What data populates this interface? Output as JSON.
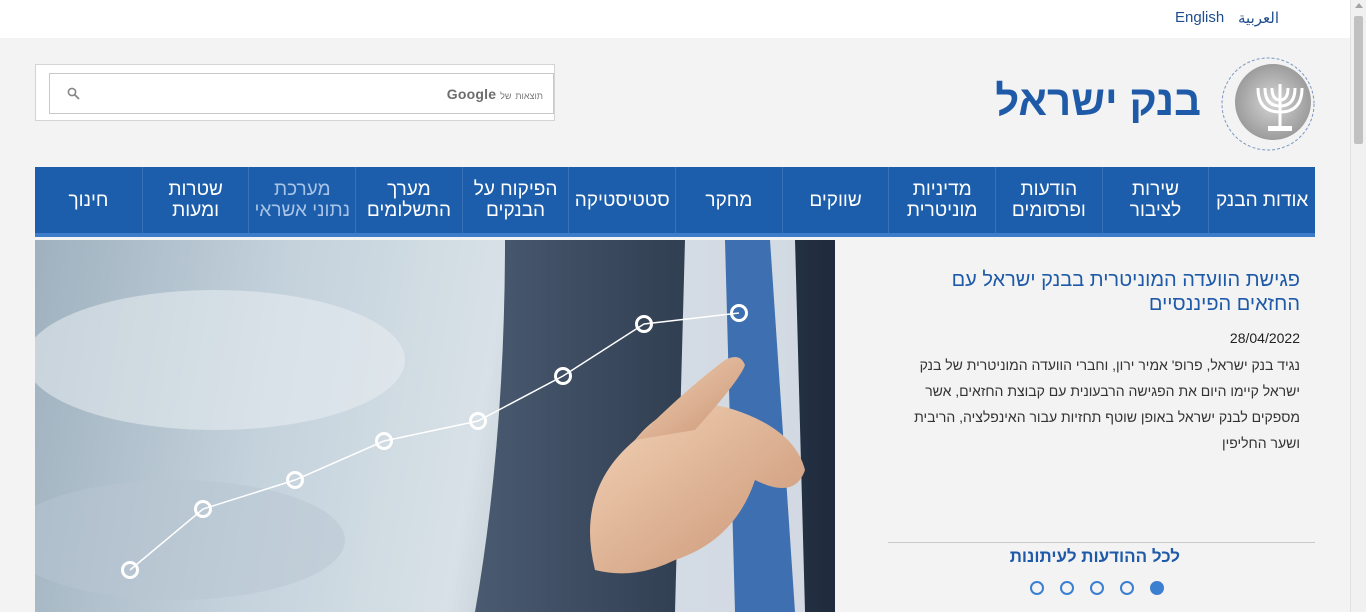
{
  "topbar": {
    "lang_arabic": "العربية",
    "lang_english": "English"
  },
  "header": {
    "site_title": "בנק ישראל",
    "logo_icon": "menorah-emblem-icon"
  },
  "search": {
    "brand_google": "Google",
    "brand_suffix": "של",
    "brand_word": "תוצאות",
    "icon": "search-icon"
  },
  "nav": {
    "items": [
      {
        "label": "אודות הבנק"
      },
      {
        "label": "שירות לציבור"
      },
      {
        "label": "הודעות ופרסומים"
      },
      {
        "label": "מדיניות מוניטרית"
      },
      {
        "label": "שווקים"
      },
      {
        "label": "מחקר"
      },
      {
        "label": "סטטיסטיקה"
      },
      {
        "label": "הפיקוח על הבנקים"
      },
      {
        "label": "מערך התשלומים"
      },
      {
        "label": "מערכת נתוני אשראי"
      },
      {
        "label": "שטרות ומעות"
      },
      {
        "label": "חינוך"
      }
    ]
  },
  "news": {
    "title": "פגישת הוועדה המוניטרית בבנק ישראל עם החזאים הפיננסיים",
    "date": "28/04/2022",
    "body": "נגיד בנק ישראל, פרופ' אמיר ירון, וחברי הוועדה המוניטרית של בנק ישראל קיימו היום את הפגישה הרבעונית עם קבוצת החזאים, אשר מספקים לבנק ישראל באופן שוטף תחזיות עבור האינפלציה, הריבית ושער החליפין",
    "all_press_link": "לכל ההודעות לעיתונות"
  },
  "carousel": {
    "slides": 5,
    "active_index": 4
  },
  "colors": {
    "brand_blue": "#1c5eab",
    "link_blue": "#1e5aa8",
    "dot_blue": "#3b7fd0"
  }
}
